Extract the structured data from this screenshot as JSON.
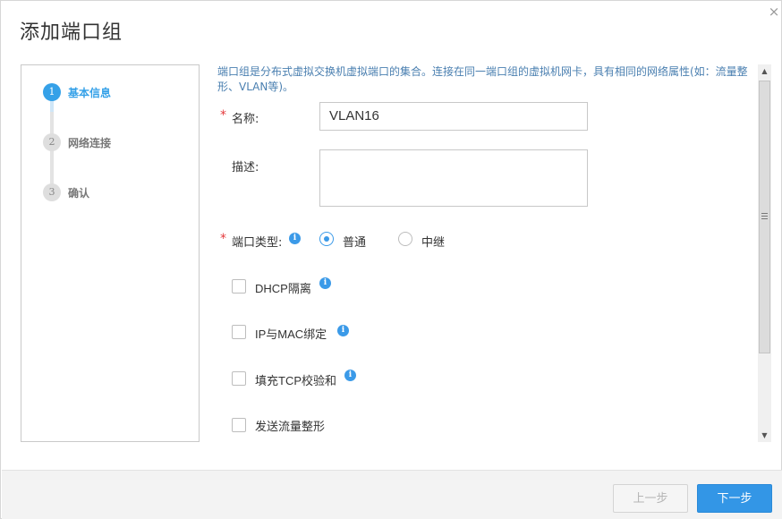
{
  "dialog": {
    "title": "添加端口组",
    "close_glyph": "×"
  },
  "steps": [
    {
      "number": "1",
      "label": "基本信息",
      "state": "active"
    },
    {
      "number": "2",
      "label": "网络连接",
      "state": "inactive"
    },
    {
      "number": "3",
      "label": "确认",
      "state": "inactive"
    }
  ],
  "description": "端口组是分布式虚拟交换机虚拟端口的集合。连接在同一端口组的虚拟机网卡，具有相同的网络属性(如：流量整形、VLAN等)。",
  "form": {
    "required_mark": "*",
    "name_label": "名称:",
    "name_value": "VLAN16",
    "desc_label": "描述:",
    "desc_value": "",
    "port_type_label": "端口类型:",
    "port_type_options": [
      {
        "label": "普通",
        "checked": true
      },
      {
        "label": "中继",
        "checked": false
      }
    ],
    "info_glyph": "i",
    "checkboxes": [
      {
        "label": "DHCP隔离",
        "checked": false,
        "has_info": true
      },
      {
        "label": "IP与MAC绑定",
        "checked": false,
        "has_info": true
      },
      {
        "label": "填充TCP校验和",
        "checked": false,
        "has_info": true
      },
      {
        "label": "发送流量整形",
        "checked": false,
        "has_info": false
      }
    ]
  },
  "scrollbar": {
    "up_glyph": "▲",
    "down_glyph": "▼"
  },
  "footer": {
    "prev_label": "上一步",
    "next_label": "下一步"
  },
  "colors": {
    "accent": "#3396e6",
    "required": "#e4393c",
    "description_text": "#4a7fb0"
  }
}
